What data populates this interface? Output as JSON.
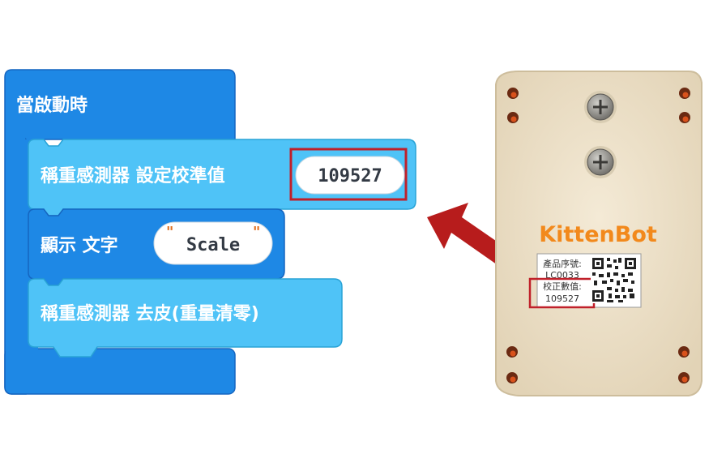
{
  "blocks": {
    "event": {
      "label": "當啟動時",
      "color": "#1e88e5",
      "border": "#1565c0"
    },
    "calibrate": {
      "label": "稱重感測器 設定校準值",
      "value": "109527",
      "color": "#4fc3f7",
      "border": "#29a3d6"
    },
    "show_text": {
      "label": "顯示 文字",
      "value": "Scale",
      "color": "#1e88e5",
      "border": "#1565c0"
    },
    "tare": {
      "label": "稱重感測器 去皮(重量清零)",
      "color": "#4fc3f7",
      "border": "#29a3d6"
    }
  },
  "highlight": {
    "color": "#c0202a"
  },
  "arrow": {
    "color": "#b71c1c"
  },
  "device": {
    "brand": "KittenBot",
    "brand_color": "#f2891c",
    "body_color": "#efe3cc",
    "label": {
      "product_serial_label": "產品序號:",
      "product_serial": "LC0033",
      "calibration_label": "校正數值:",
      "calibration_value": "109527"
    }
  }
}
